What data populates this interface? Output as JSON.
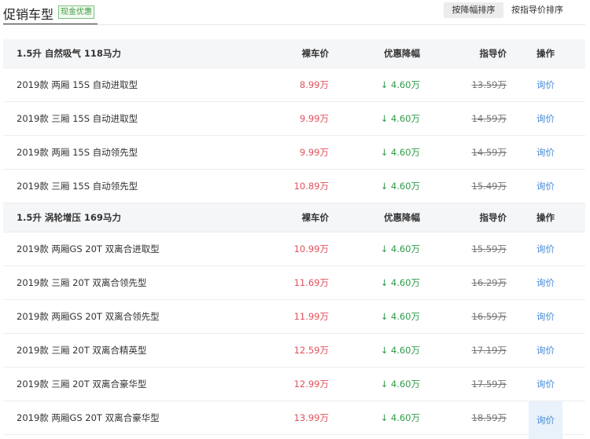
{
  "header": {
    "title": "促销车型",
    "badge": "现金优惠",
    "sort_by_discount": "按降幅排序",
    "sort_by_guide": "按指导价排序"
  },
  "table": {
    "groups": [
      {
        "label": "1.5升 自然吸气 118马力",
        "col_price": "裸车价",
        "col_discount": "优惠降幅",
        "col_guide": "指导价",
        "col_op": "操作",
        "rows": [
          {
            "name": "2019款 两厢 15S 自动进取型",
            "price": "8.99万",
            "discount": "↓ 4.60万",
            "guide": "13.59万",
            "op": "询价"
          },
          {
            "name": "2019款 三厢 15S 自动进取型",
            "price": "9.99万",
            "discount": "↓ 4.60万",
            "guide": "14.59万",
            "op": "询价"
          },
          {
            "name": "2019款 两厢 15S 自动领先型",
            "price": "9.99万",
            "discount": "↓ 4.60万",
            "guide": "14.59万",
            "op": "询价"
          },
          {
            "name": "2019款 三厢 15S 自动领先型",
            "price": "10.89万",
            "discount": "↓ 4.60万",
            "guide": "15.49万",
            "op": "询价"
          }
        ]
      },
      {
        "label": "1.5升 涡轮增压 169马力",
        "col_price": "裸车价",
        "col_discount": "优惠降幅",
        "col_guide": "指导价",
        "col_op": "操作",
        "rows": [
          {
            "name": "2019款 两厢GS 20T 双离合进取型",
            "price": "10.99万",
            "discount": "↓ 4.60万",
            "guide": "15.59万",
            "op": "询价"
          },
          {
            "name": "2019款 三厢 20T 双离合领先型",
            "price": "11.69万",
            "discount": "↓ 4.60万",
            "guide": "16.29万",
            "op": "询价"
          },
          {
            "name": "2019款 两厢GS 20T 双离合领先型",
            "price": "11.99万",
            "discount": "↓ 4.60万",
            "guide": "16.59万",
            "op": "询价"
          },
          {
            "name": "2019款 三厢 20T 双离合精英型",
            "price": "12.59万",
            "discount": "↓ 4.60万",
            "guide": "17.19万",
            "op": "询价"
          },
          {
            "name": "2019款 三厢 20T 双离合豪华型",
            "price": "12.99万",
            "discount": "↓ 4.60万",
            "guide": "17.59万",
            "op": "询价"
          },
          {
            "name": "2019款 两厢GS 20T 双离合豪华型",
            "price": "13.99万",
            "discount": "↓ 4.60万",
            "guide": "18.59万",
            "op": "询价"
          }
        ]
      }
    ]
  }
}
